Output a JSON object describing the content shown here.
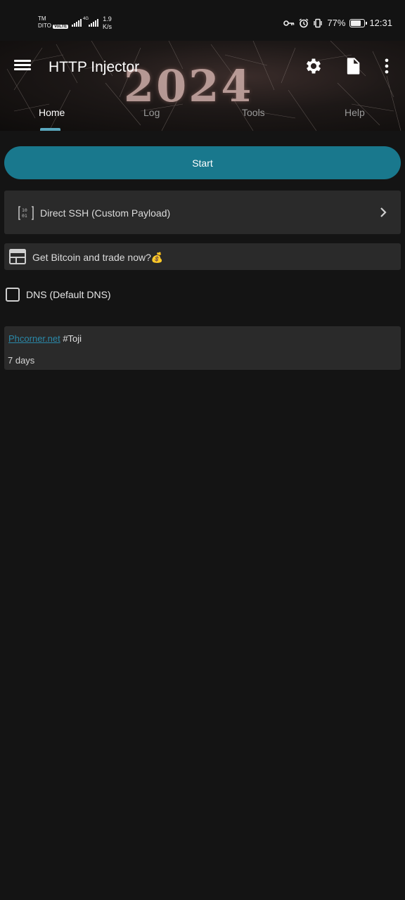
{
  "status_bar": {
    "carrier_top": "TM",
    "carrier_bottom": "DITO",
    "volte": "VoLTE",
    "net_type": "4G",
    "speed_value": "1.9",
    "speed_unit": "K/s",
    "icons": [
      "key-icon",
      "alarm-icon",
      "vibrate-icon"
    ],
    "battery_percent": "77%",
    "battery_level": 0.77,
    "time": "12:31"
  },
  "header": {
    "title": "HTTP Injector",
    "background_text": "2024",
    "icons": [
      "menu-icon",
      "gear-icon",
      "file-icon",
      "more-vert-icon"
    ]
  },
  "tabs": [
    {
      "label": "Home",
      "active": true
    },
    {
      "label": "Log",
      "active": false
    },
    {
      "label": "Tools",
      "active": false
    },
    {
      "label": "Help",
      "active": false
    }
  ],
  "main": {
    "start_label": "Start",
    "tunnel_mode": "Direct SSH (Custom Payload)",
    "promo_text": "Get Bitcoin and trade now?💰",
    "dns_label": "DNS (Default DNS)",
    "dns_checked": false,
    "note": {
      "link_text": "Phcorner.net",
      "tag_text": " #Toji",
      "expiry": "7 days"
    }
  },
  "colors": {
    "accent": "#19788d",
    "tab_indicator": "#5aa7bd",
    "background": "#141414",
    "card": "#2a2a2a",
    "link": "#2a88a8"
  }
}
